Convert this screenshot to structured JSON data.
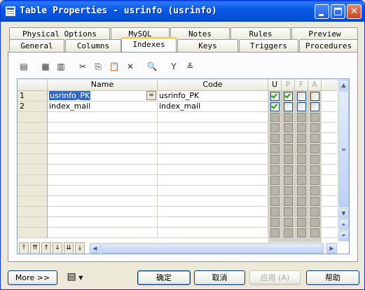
{
  "window": {
    "title": "Table Properties - usrinfo (usrinfo)",
    "minimize_glyph": "",
    "maximize_glyph": "",
    "close_glyph": "✕"
  },
  "tabs_back": [
    "Physical Options",
    "MySQL",
    "Notes",
    "Rules",
    "Preview"
  ],
  "tabs_front": [
    "General",
    "Columns",
    "Indexes",
    "Keys",
    "Triggers",
    "Procedures"
  ],
  "active_tab": "Indexes",
  "toolbar": {
    "icons": [
      "properties-icon",
      "add-row-icon",
      "insert-row-icon",
      "cut-icon",
      "copy-icon",
      "paste-icon",
      "delete-icon",
      "find-icon",
      "filter-icon",
      "customize-columns-icon"
    ],
    "glyphs": [
      "▤",
      "▦",
      "▥",
      "✂",
      "⎘",
      "📋",
      "✕",
      "🔍",
      "Y",
      "≚"
    ]
  },
  "grid": {
    "columns": [
      "Name",
      "Code",
      "U",
      "P",
      "F",
      "A"
    ],
    "rows": [
      {
        "num": "1",
        "name": "usrinfo_PK",
        "code": "usrinfo_PK",
        "u": true,
        "p": true,
        "f": false,
        "a": false
      },
      {
        "num": "2",
        "name": "index_mail",
        "code": "index_mail",
        "u": true,
        "p": false,
        "f": false,
        "a": false
      }
    ],
    "empty_rows": 12,
    "combo_glyph": "="
  },
  "nav_glyphs": [
    "⤒",
    "⇈",
    "↑",
    "↓",
    "⇊",
    "⤓"
  ],
  "buttons": {
    "more": "More >>",
    "ok": "确定",
    "cancel": "取消",
    "apply": "应用 (A)",
    "help": "帮助"
  }
}
